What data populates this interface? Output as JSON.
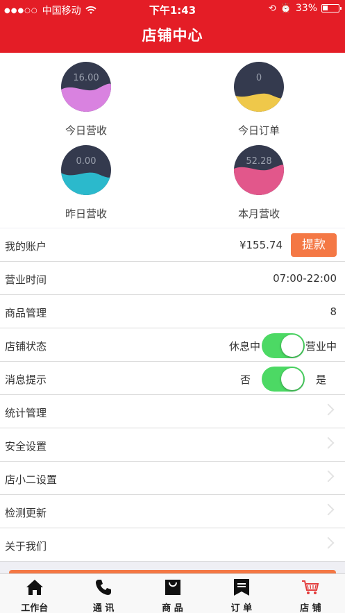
{
  "status_bar": {
    "carrier": "中国移动",
    "time": "下午1:43",
    "battery": "33%"
  },
  "header": {
    "title": "店铺中心"
  },
  "stats": [
    {
      "value": "16.00",
      "label": "今日营收",
      "color": "#d982e0"
    },
    {
      "value": "0",
      "label": "今日订单",
      "color": "#efc84a"
    },
    {
      "value": "0.00",
      "label": "昨日营收",
      "color": "#2bb9cc"
    },
    {
      "value": "52.28",
      "label": "本月营收",
      "color": "#e2578b"
    }
  ],
  "list": {
    "account": {
      "label": "我的账户",
      "balance": "¥155.74",
      "button": "提款"
    },
    "hours": {
      "label": "营业时间",
      "value": "07:00-22:00"
    },
    "products": {
      "label": "商品管理",
      "value": "8"
    },
    "store_status": {
      "label": "店铺状态",
      "off_text": "休息中",
      "on_text": "营业中"
    },
    "notifications": {
      "label": "消息提示",
      "off_text": "否",
      "on_text": "是"
    },
    "stats_mgmt": {
      "label": "统计管理"
    },
    "security": {
      "label": "安全设置"
    },
    "assistant": {
      "label": "店小二设置"
    },
    "updates": {
      "label": "检测更新"
    },
    "about": {
      "label": "关于我们"
    }
  },
  "tabs": [
    {
      "label": "工作台",
      "icon": "home-icon"
    },
    {
      "label": "通 讯",
      "icon": "phone-icon"
    },
    {
      "label": "商 品",
      "icon": "shopping-bag-icon"
    },
    {
      "label": "订 单",
      "icon": "order-flag-icon"
    },
    {
      "label": "店 铺",
      "icon": "cart-icon"
    }
  ],
  "colors": {
    "brand_red": "#e41d26",
    "accent_orange": "#f47845",
    "toggle_green": "#4cd964",
    "cart_red": "#e33d3d"
  }
}
